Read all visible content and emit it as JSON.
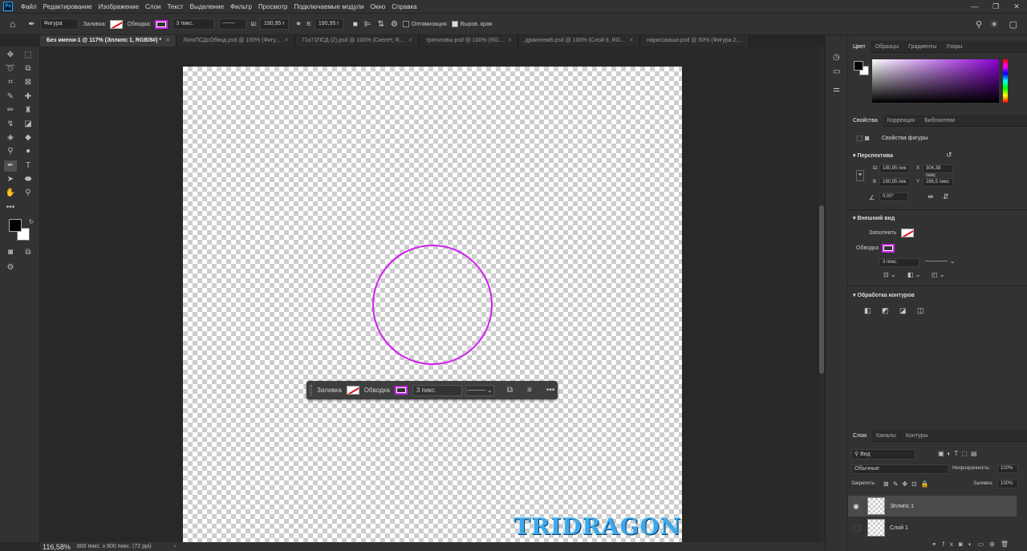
{
  "menu": {
    "items": [
      "Файл",
      "Редактирование",
      "Изображение",
      "Слои",
      "Текст",
      "Выделение",
      "Фильтр",
      "Просмотр",
      "Подключаемые модули",
      "Окно",
      "Справка"
    ]
  },
  "options": {
    "mode": "Фигура",
    "fill_label": "Заливка:",
    "stroke_label": "Обводка:",
    "stroke_width": "3 пикс.",
    "w_label": "Ш:",
    "w_value": "190,95 г",
    "h_label": "В:",
    "h_value": "190,95 г",
    "optimize_label": "Оптимизация",
    "align_edges_label": "Выров. края"
  },
  "tabs": [
    {
      "label": "Без имени-1 @ 117% (Эллипс 1, RGB/8#) *",
      "active": true
    },
    {
      "label": "ЛогоПСДсОбвод.psd @ 100% (Фигу..."
    },
    {
      "label": "71x71ПСД (2).psd @ 100% (Скелет, R..."
    },
    {
      "label": "триголовы.psd @ 100% (RG..."
    },
    {
      "label": "драконэм6.psd @ 100% (Слой 9, RG..."
    },
    {
      "label": "нарисоваши.psd @ 50% (Фигура 2,..."
    }
  ],
  "contextbar": {
    "fill_label": "Заливка",
    "stroke_label": "Обводка",
    "stroke_width": "3 пикс."
  },
  "watermark": "TRIDRAGON",
  "status": {
    "zoom": "116,58%",
    "doc_info": "800 пикс. x 800 пикс. (72 ppi)"
  },
  "color_panel": {
    "tabs": [
      "Цвет",
      "Образцы",
      "Градиенты",
      "Узоры"
    ],
    "fg": "#000000",
    "bg": "#ffffff",
    "hue": "#8a00d4"
  },
  "properties": {
    "tabs": [
      "Свойства",
      "Коррекция",
      "Библиотеки"
    ],
    "subtitle": "Свойства фигуры",
    "perspective_title": "Перспектива",
    "w_label": "Ш",
    "w_value": "190,95 пик",
    "x_label": "X",
    "x_value": "304,38 пикс",
    "h_label": "В",
    "h_value": "190,95 пик",
    "y_label": "Y",
    "y_value": "286,5 пикс",
    "angle_value": "0,00°",
    "appearance_title": "Внешний вид",
    "fill_label": "Заполнить",
    "stroke_label": "Обводка",
    "stroke_width": "3 пикс.",
    "path_ops_title": "Обработка контуров"
  },
  "layers": {
    "tabs": [
      "Слои",
      "Каналы",
      "Контуры"
    ],
    "filter": "Вид",
    "blend_mode": "Обычные",
    "opacity_label": "Непрозрачность:",
    "opacity": "100%",
    "lock_label": "Закрепить:",
    "fill_label": "Заливка:",
    "fill": "100%",
    "items": [
      {
        "name": "Эллипс 1",
        "visible": true,
        "selected": true
      },
      {
        "name": "Слой 1",
        "visible": false,
        "selected": false
      }
    ]
  },
  "colors": {
    "stroke": "#d020f0",
    "accent": "#31a8ff"
  }
}
